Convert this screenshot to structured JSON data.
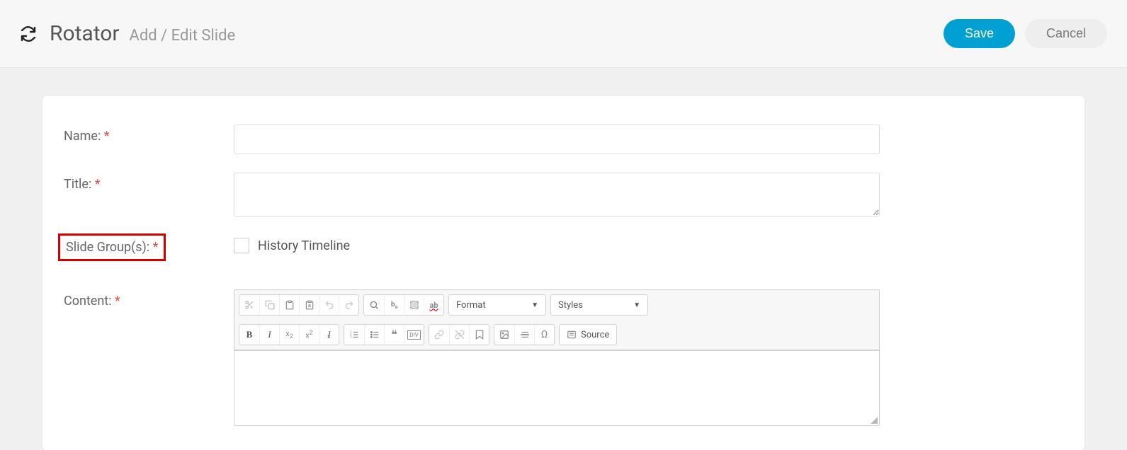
{
  "header": {
    "title": "Rotator",
    "subtitle": "Add / Edit Slide",
    "save_label": "Save",
    "cancel_label": "Cancel"
  },
  "form": {
    "name_label": "Name:",
    "name_value": "",
    "title_label": "Title:",
    "title_value": "",
    "slide_groups_label": "Slide Group(s):",
    "slide_groups_option": "History Timeline",
    "content_label": "Content:"
  },
  "editor": {
    "format_label": "Format",
    "styles_label": "Styles",
    "source_label": "Source"
  }
}
